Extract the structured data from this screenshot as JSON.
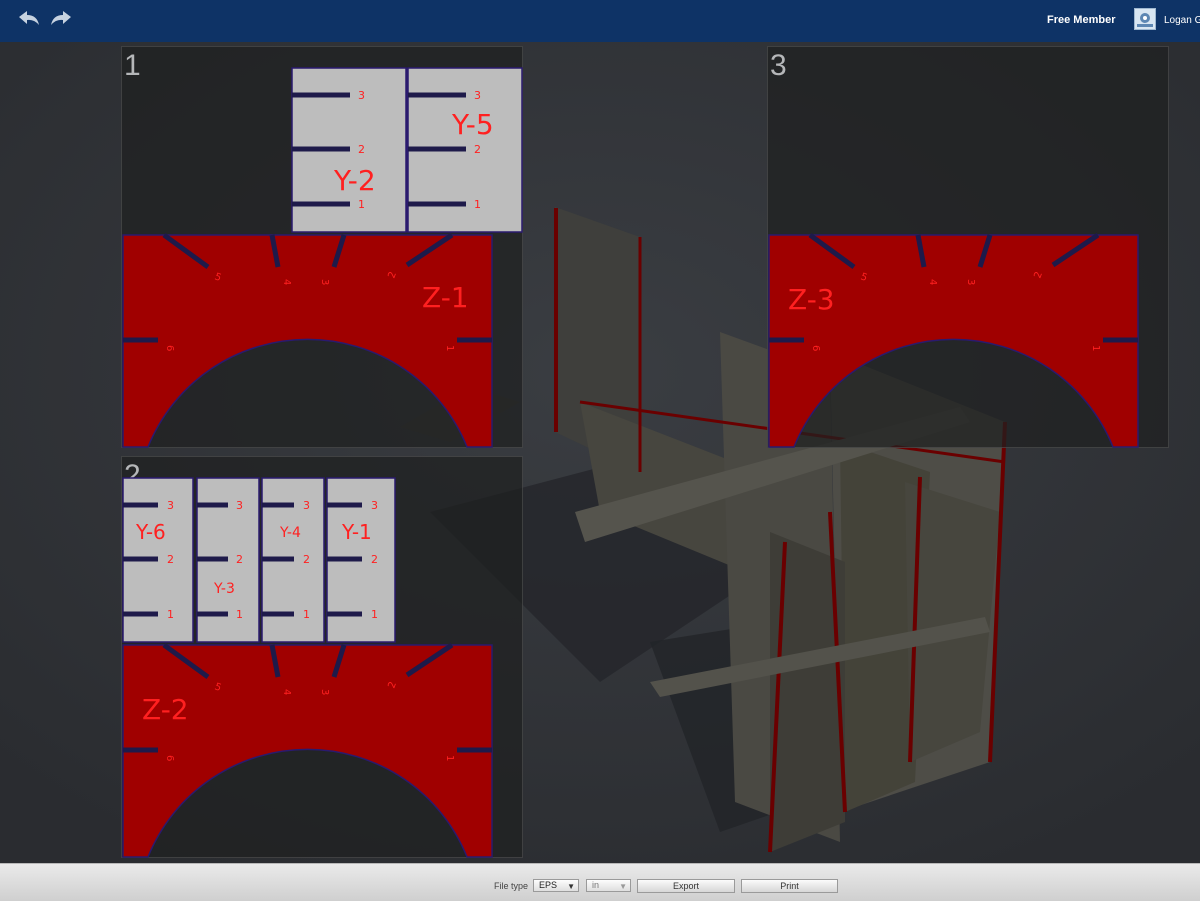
{
  "topbar": {
    "undo_icon": "undo-arrow-icon",
    "redo_icon": "redo-arrow-icon",
    "membership": "Free Member",
    "avatar_icon": "user-avatar-icon",
    "username": "Logan G"
  },
  "sheets": [
    {
      "number": "1",
      "labels": [
        "Y-2",
        "Y-5",
        "Z-1"
      ],
      "slot_numbers": [
        "3",
        "2",
        "1"
      ]
    },
    {
      "number": "2",
      "labels": [
        "Y-6",
        "Y-3",
        "Y-4",
        "Y-1",
        "Z-2"
      ],
      "slot_numbers": [
        "3",
        "2",
        "1"
      ]
    },
    {
      "number": "3",
      "labels": [
        "Z-3"
      ]
    }
  ],
  "colors": {
    "topbar": "#0e3366",
    "y_piece_fill": "#bdbdbd",
    "z_piece_fill": "#a00000",
    "cut_line": "#2a1a6e",
    "label_text": "#ff2020"
  },
  "bottombar": {
    "filetype_label": "File type",
    "filetype_value": "EPS",
    "unit_value": "in",
    "export_label": "Export",
    "print_label": "Print"
  }
}
